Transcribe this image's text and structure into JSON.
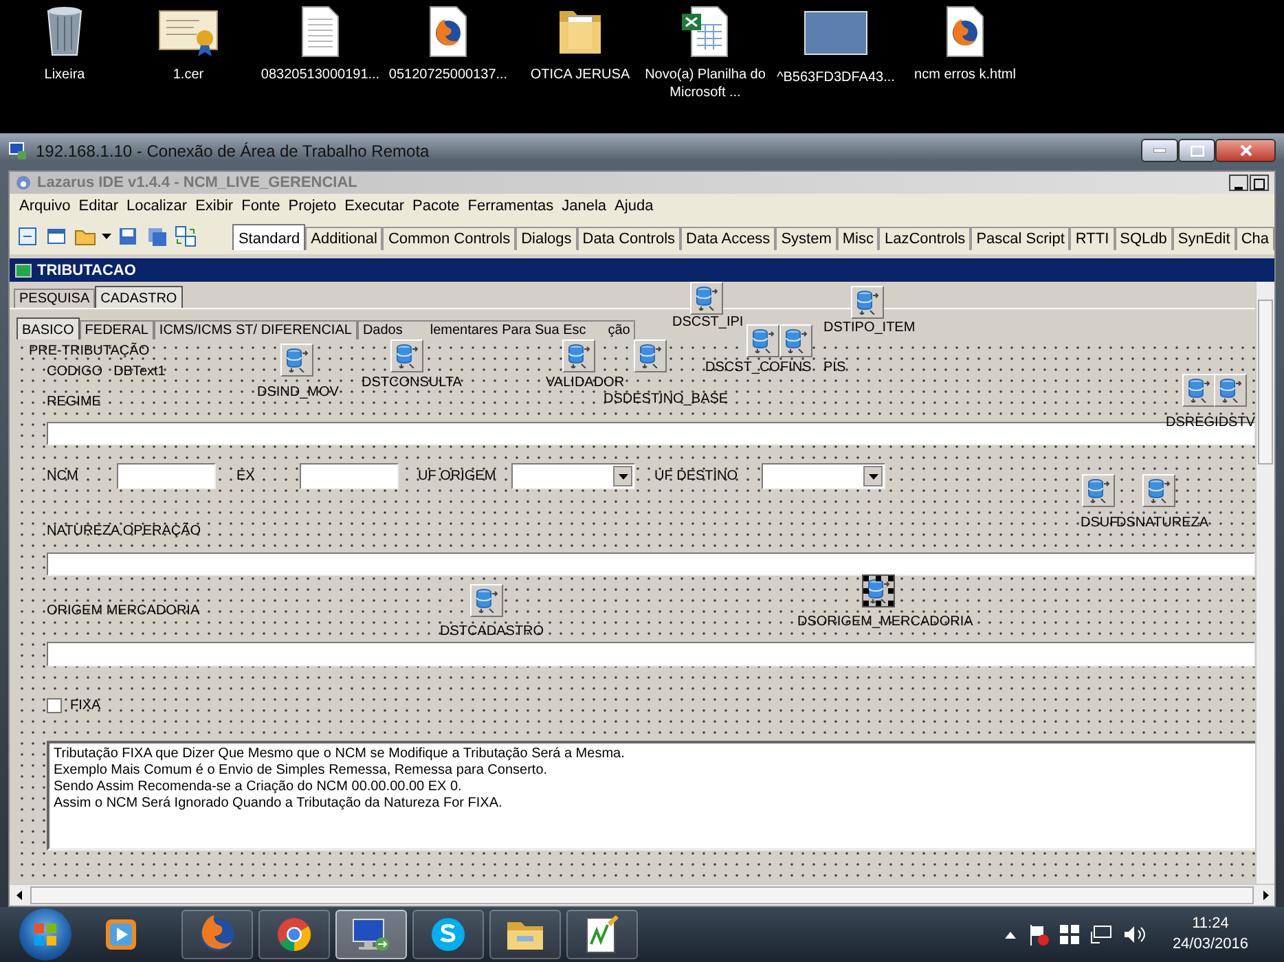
{
  "desktop_icons": [
    {
      "label": "Lixeira",
      "kind": "recycle"
    },
    {
      "label": "1.cer",
      "kind": "certificate"
    },
    {
      "label": "08320513000191...",
      "kind": "document"
    },
    {
      "label": "05120725000137...",
      "kind": "firefox"
    },
    {
      "label": "OTICA JERUSA",
      "kind": "folder"
    },
    {
      "label": "Novo(a) Planilha do Microsoft ...",
      "kind": "spreadsheet"
    },
    {
      "label": "^B563FD3DFA43...",
      "kind": "photo"
    },
    {
      "label": "ncm erros k.html",
      "kind": "firefox"
    }
  ],
  "remote_window": {
    "title": "192.168.1.10 - Conexão de Área de Trabalho Remota"
  },
  "ide": {
    "title": "Lazarus IDE v1.4.4 - NCM_LIVE_GERENCIAL",
    "menu": [
      "Arquivo",
      "Editar",
      "Localizar",
      "Exibir",
      "Fonte",
      "Projeto",
      "Executar",
      "Pacote",
      "Ferramentas",
      "Janela",
      "Ajuda"
    ],
    "palette_tabs": [
      {
        "label": "Standard",
        "selected": true
      },
      {
        "label": "Additional",
        "selected": false
      },
      {
        "label": "Common Controls",
        "selected": false
      },
      {
        "label": "Dialogs",
        "selected": false
      },
      {
        "label": "Data Controls",
        "selected": false
      },
      {
        "label": "Data Access",
        "selected": false
      },
      {
        "label": "System",
        "selected": false
      },
      {
        "label": "Misc",
        "selected": false
      },
      {
        "label": "LazControls",
        "selected": false
      },
      {
        "label": "Pascal Script",
        "selected": false
      },
      {
        "label": "RTTI",
        "selected": false
      },
      {
        "label": "SQLdb",
        "selected": false
      },
      {
        "label": "SynEdit",
        "selected": false
      },
      {
        "label": "Cha",
        "selected": false
      }
    ]
  },
  "form": {
    "title": "TRIBUTACAO",
    "tabs": [
      {
        "label": "PESQUISA",
        "selected": false
      },
      {
        "label": "CADASTRO",
        "selected": true
      }
    ],
    "subtabs": [
      {
        "label_parts": [
          "BASICO"
        ],
        "selected": true
      },
      {
        "label_parts": [
          "FEDERAL"
        ],
        "selected": false
      },
      {
        "label_parts": [
          "ICMS/ICMS ST/ DIFERENCIAL"
        ],
        "selected": false
      },
      {
        "label_parts": [
          "Dados",
          "lementares Para Sua Esc",
          "ção"
        ],
        "selected": false
      }
    ],
    "group_title": "PRE-TRIBUTAÇÃO",
    "codigo": {
      "label": "CODIGO",
      "value": "DBText1"
    },
    "regime_label": "REGIME",
    "ncm_label": "NCM",
    "ex_label": "EX",
    "uf_origem_label": "UF ORIGEM",
    "uf_destino_label": "UF DESTINO",
    "natureza_label": "NATUREZA OPERAÇÃO",
    "origem_label": "ORIGEM MERCADORIA",
    "fixa": {
      "label": "FIXA",
      "checked": false
    },
    "memo_lines": [
      "Tributação FIXA que Dizer Que Mesmo que o NCM se Modifique a Tributação Será a Mesma.",
      "Exemplo Mais Comum é o Envio de Simples Remessa, Remessa para Conserto.",
      "Sendo Assim Recomenda-se a Criação do NCM 00.00.00.00  EX 0.",
      "Assim o NCM Será Ignorado Quando a Tributação da Natureza For FIXA."
    ],
    "components": [
      {
        "label": "DSCST_IPI",
        "selected": false
      },
      {
        "label": "DSTIPO_ITEM",
        "selected": false
      },
      {
        "label": "DSCST_COFINS",
        "selected": false
      },
      {
        "label": "PIS",
        "selected": false
      },
      {
        "label": "DSTCONSULTA",
        "selected": false
      },
      {
        "label": "VALIDADOR",
        "selected": false
      },
      {
        "label": "DSDESTINO_BASE",
        "selected": false
      },
      {
        "label": "DSIND_MOV",
        "selected": false
      },
      {
        "label": "DSREGIDSTV",
        "selected": false
      },
      {
        "label": "DSUF",
        "selected": false
      },
      {
        "label": "DSNATUREZA",
        "selected": false
      },
      {
        "label": "DSTCADASTRO",
        "selected": false
      },
      {
        "label": "DSORIGEM_MERCADORIA",
        "selected": true
      }
    ]
  },
  "taskbar": {
    "apps": [
      {
        "kind": "media",
        "selected": false
      },
      {
        "kind": "firefox",
        "selected": false
      },
      {
        "kind": "chrome",
        "selected": false
      },
      {
        "kind": "remote",
        "selected": true
      },
      {
        "kind": "skype",
        "selected": false
      },
      {
        "kind": "explorer",
        "selected": false
      },
      {
        "kind": "notepad",
        "selected": false
      }
    ],
    "time": "11:24",
    "date": "24/03/2016"
  }
}
